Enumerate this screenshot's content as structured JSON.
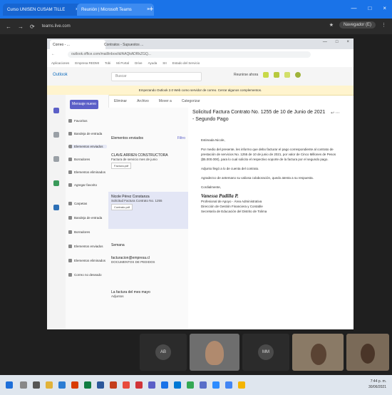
{
  "outer_browser": {
    "tab1": "Curso UNISEN CUSAM TILLE",
    "tab2": "Reunión | Microsoft Teams",
    "url": "teams.live.com",
    "controls": [
      "—",
      "□",
      "×"
    ],
    "right_pill": "Navegador (E)"
  },
  "inner_browser": {
    "tab1": "Correo - ...",
    "tab2": "Contratos - Supuestos ...",
    "url": "outlook.office.com/mail/inbox/id/AAQkADRkZGQ...",
    "bookmarks": [
      "Aplicaciones",
      "Empresa REDMI",
      "Tobi",
      "Mi Portal",
      "Drive",
      "Ayuda",
      "SII",
      "Estado del Servicio"
    ]
  },
  "outlook": {
    "brand": "Outlook",
    "search": "Buscar",
    "meet_now": "Reunirse ahora",
    "banner": "Empezando Outlook 2.0 Web como servidor de correo. Cerrar algunos complementos.",
    "new_mail": "Mensaje nuevo",
    "folders": [
      "Favoritos",
      "Bandeja de entrada",
      "Elementos enviados",
      "Borradores",
      "Elementos eliminados",
      "Agregar favorito",
      "Carpetas",
      "Bandeja de entrada",
      "Borradores",
      "Elementos enviados",
      "Elementos eliminados",
      "Correo no deseado"
    ],
    "toolbar": [
      "Eliminar",
      "Archivo",
      "Mover a",
      "Categorizar"
    ],
    "list_header": "Elementos enviados",
    "list_filter": "Filtro",
    "cards": [
      {
        "from": "CLAVE ARRIEN CONSTRUCTORA",
        "preview": "Factura de servicio mes de junio",
        "attach": "Factura.pdf"
      },
      {
        "from": "Nicole Pérez Constanza",
        "preview": "Solicitud Factura Contrato No. 1255",
        "attach": "Contrato.pdf"
      },
      {
        "from": "Semana",
        "preview": ""
      },
      {
        "from": "facturacion@empresa.cl",
        "preview": "DOCUMENTOS DE PEDIDOS"
      },
      {
        "from": "La factura del mes mayo",
        "preview": "Adjuntos"
      }
    ],
    "subject": "Solicitud Factura Contrato No. 1255 de 10 de Junio de 2021 - Segundo Pago",
    "body": [
      "Estimada Nicole,",
      "Por medio del presente, les informo que debo facturar el pago correspondiente al contrato de prestación de servicios No. 1255 de 10 de junio de 2021, por valor de Cinco Millones de Pesos ($5.000.000), para lo cual solicito el respectivo soporte de la factura por el segundo pago.",
      "Adjunto llegó a lo de cuenta del contrato.",
      "Agradezco de antemano su valiosa colaboración, quedo atenta a su respuesta.",
      "Cordialmente,"
    ],
    "signature": "Vanessa Padilla P.",
    "sig_lines": [
      "Profesional de Apoyo - Área Administrativa",
      "Dirección de Gestión Financiera y Contable",
      "Secretaría de Educación del Distrito de Tolima"
    ]
  },
  "meeting": {
    "tiles": [
      "AB",
      "MM"
    ]
  },
  "taskbar": {
    "time": "7:44 p. m.",
    "date": "30/06/2021"
  }
}
